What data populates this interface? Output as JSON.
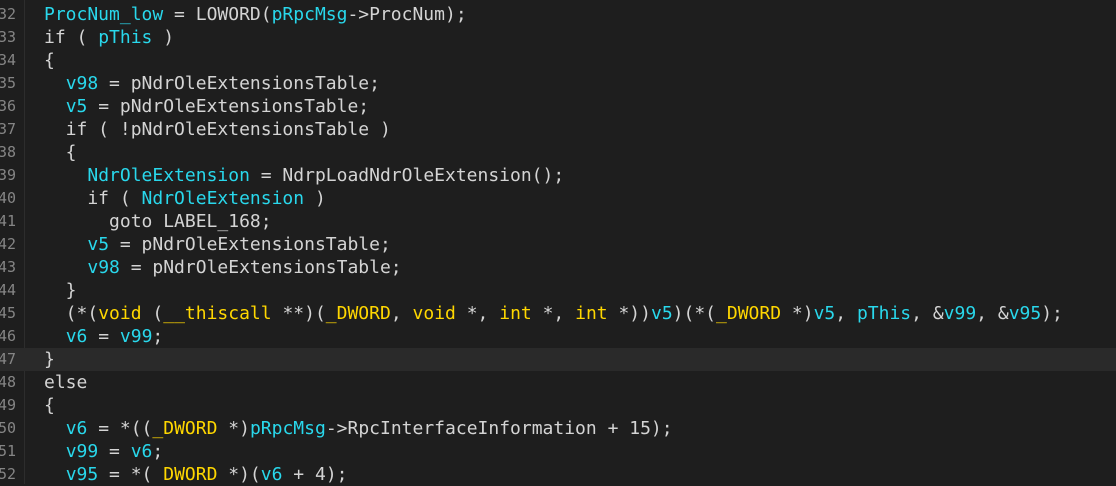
{
  "editor": {
    "lines": [
      {
        "num": "32",
        "tokens": [
          {
            "c": "v",
            "t": "ProcNum_low"
          },
          {
            "c": "p",
            "t": " = LOWORD("
          },
          {
            "c": "v",
            "t": "pRpcMsg"
          },
          {
            "c": "p",
            "t": "->ProcNum);"
          }
        ]
      },
      {
        "num": "33",
        "tokens": [
          {
            "c": "p",
            "t": "if ( "
          },
          {
            "c": "v",
            "t": "pThis"
          },
          {
            "c": "p",
            "t": " )"
          }
        ]
      },
      {
        "num": "34",
        "tokens": [
          {
            "c": "p",
            "t": "{"
          }
        ]
      },
      {
        "num": "35",
        "tokens": [
          {
            "c": "p",
            "t": "  "
          },
          {
            "c": "v",
            "t": "v98"
          },
          {
            "c": "p",
            "t": " = pNdrOleExtensionsTable;"
          }
        ]
      },
      {
        "num": "36",
        "tokens": [
          {
            "c": "p",
            "t": "  "
          },
          {
            "c": "v",
            "t": "v5"
          },
          {
            "c": "p",
            "t": " = pNdrOleExtensionsTable;"
          }
        ]
      },
      {
        "num": "37",
        "tokens": [
          {
            "c": "p",
            "t": "  if ( !pNdrOleExtensionsTable )"
          }
        ]
      },
      {
        "num": "38",
        "tokens": [
          {
            "c": "p",
            "t": "  {"
          }
        ]
      },
      {
        "num": "39",
        "tokens": [
          {
            "c": "p",
            "t": "    "
          },
          {
            "c": "v",
            "t": "NdrOleExtension"
          },
          {
            "c": "p",
            "t": " = NdrpLoadNdrOleExtension();"
          }
        ]
      },
      {
        "num": "40",
        "tokens": [
          {
            "c": "p",
            "t": "    if ( "
          },
          {
            "c": "v",
            "t": "NdrOleExtension"
          },
          {
            "c": "p",
            "t": " )"
          }
        ]
      },
      {
        "num": "41",
        "tokens": [
          {
            "c": "p",
            "t": "      goto LABEL_168;"
          }
        ]
      },
      {
        "num": "42",
        "tokens": [
          {
            "c": "p",
            "t": "    "
          },
          {
            "c": "v",
            "t": "v5"
          },
          {
            "c": "p",
            "t": " = pNdrOleExtensionsTable;"
          }
        ]
      },
      {
        "num": "43",
        "tokens": [
          {
            "c": "p",
            "t": "    "
          },
          {
            "c": "v",
            "t": "v98"
          },
          {
            "c": "p",
            "t": " = pNdrOleExtensionsTable;"
          }
        ]
      },
      {
        "num": "44",
        "tokens": [
          {
            "c": "p",
            "t": "  }"
          }
        ]
      },
      {
        "num": "45",
        "tokens": [
          {
            "c": "p",
            "t": "  (*("
          },
          {
            "c": "t",
            "t": "void"
          },
          {
            "c": "p",
            "t": " ("
          },
          {
            "c": "t",
            "t": "__thiscall"
          },
          {
            "c": "p",
            "t": " **)("
          },
          {
            "c": "t",
            "t": "_DWORD"
          },
          {
            "c": "p",
            "t": ", "
          },
          {
            "c": "t",
            "t": "void"
          },
          {
            "c": "p",
            "t": " *, "
          },
          {
            "c": "t",
            "t": "int"
          },
          {
            "c": "p",
            "t": " *, "
          },
          {
            "c": "t",
            "t": "int"
          },
          {
            "c": "p",
            "t": " *))"
          },
          {
            "c": "v",
            "t": "v5"
          },
          {
            "c": "p",
            "t": ")(*("
          },
          {
            "c": "t",
            "t": "_DWORD"
          },
          {
            "c": "p",
            "t": " *)"
          },
          {
            "c": "v",
            "t": "v5"
          },
          {
            "c": "p",
            "t": ", "
          },
          {
            "c": "v",
            "t": "pThis"
          },
          {
            "c": "p",
            "t": ", &"
          },
          {
            "c": "v",
            "t": "v99"
          },
          {
            "c": "p",
            "t": ", &"
          },
          {
            "c": "v",
            "t": "v95"
          },
          {
            "c": "p",
            "t": ");"
          }
        ]
      },
      {
        "num": "46",
        "tokens": [
          {
            "c": "p",
            "t": "  "
          },
          {
            "c": "v",
            "t": "v6"
          },
          {
            "c": "p",
            "t": " = "
          },
          {
            "c": "v",
            "t": "v99"
          },
          {
            "c": "p",
            "t": ";"
          }
        ]
      },
      {
        "num": "47",
        "current": true,
        "tokens": [
          {
            "c": "p",
            "t": "}"
          }
        ]
      },
      {
        "num": "48",
        "tokens": [
          {
            "c": "p",
            "t": "else"
          }
        ]
      },
      {
        "num": "49",
        "tokens": [
          {
            "c": "p",
            "t": "{"
          }
        ]
      },
      {
        "num": "50",
        "tokens": [
          {
            "c": "p",
            "t": "  "
          },
          {
            "c": "v",
            "t": "v6"
          },
          {
            "c": "p",
            "t": " = *(("
          },
          {
            "c": "t",
            "t": "_DWORD"
          },
          {
            "c": "p",
            "t": " *)"
          },
          {
            "c": "v",
            "t": "pRpcMsg"
          },
          {
            "c": "p",
            "t": "->RpcInterfaceInformation + 15);"
          }
        ]
      },
      {
        "num": "51",
        "tokens": [
          {
            "c": "p",
            "t": "  "
          },
          {
            "c": "v",
            "t": "v99"
          },
          {
            "c": "p",
            "t": " = "
          },
          {
            "c": "v",
            "t": "v6"
          },
          {
            "c": "p",
            "t": ";"
          }
        ]
      },
      {
        "num": "52",
        "tokens": [
          {
            "c": "p",
            "t": "  "
          },
          {
            "c": "v",
            "t": "v95"
          },
          {
            "c": "p",
            "t": " = *( "
          },
          {
            "c": "t",
            "t": "DWORD"
          },
          {
            "c": "p",
            "t": " *)("
          },
          {
            "c": "v",
            "t": "v6"
          },
          {
            "c": "p",
            "t": " + 4);"
          }
        ]
      }
    ]
  }
}
